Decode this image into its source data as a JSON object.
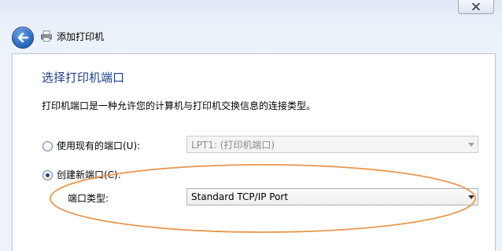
{
  "window": {
    "title": "添加打印机",
    "close_icon": "close-icon",
    "back_icon": "back-arrow-icon",
    "printer_icon": "printer-icon"
  },
  "page": {
    "heading": "选择打印机端口",
    "description": "打印机端口是一种允许您的计算机与打印机交换信息的连接类型。"
  },
  "options": {
    "use_existing": {
      "label": "使用现有的端口(U):",
      "selected": false,
      "combo_value": "LPT1: (打印机端口)",
      "enabled": false
    },
    "create_new": {
      "label": "创建新端口(C):",
      "selected": true,
      "port_type_label": "端口类型:",
      "combo_value": "Standard TCP/IP Port"
    }
  },
  "colors": {
    "heading": "#1e3f8f",
    "annotation": "#e8964c",
    "back_button": "#2f6fc4"
  }
}
